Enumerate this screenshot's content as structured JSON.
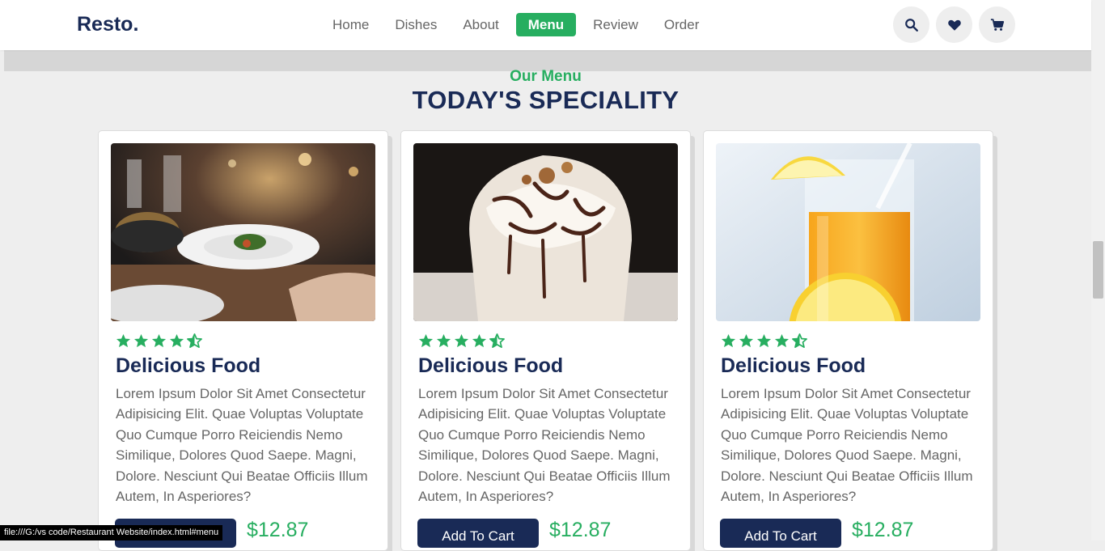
{
  "header": {
    "logo": "Resto.",
    "nav": [
      "Home",
      "Dishes",
      "About",
      "Menu",
      "Review",
      "Order"
    ],
    "active_nav": "Menu",
    "icons": [
      "search-icon",
      "heart-icon",
      "cart-icon"
    ]
  },
  "section": {
    "subheading": "Our Menu",
    "heading": "TODAY'S SPECIALITY"
  },
  "cards": [
    {
      "image": "restaurant-dinner-photo",
      "rating": 4.5,
      "title": "Delicious Food",
      "description": "Lorem Ipsum Dolor Sit Amet Consectetur Adipisicing Elit. Quae Voluptas Voluptate Quo Cumque Porro Reiciendis Nemo Similique, Dolores Quod Saepe. Magni, Dolore. Nesciunt Qui Beatae Officiis Illum Autem, In Asperiores?",
      "button": "Add To Cart",
      "price": "$12.87"
    },
    {
      "image": "whipped-cream-dessert-photo",
      "rating": 4.5,
      "title": "Delicious Food",
      "description": "Lorem Ipsum Dolor Sit Amet Consectetur Adipisicing Elit. Quae Voluptas Voluptate Quo Cumque Porro Reiciendis Nemo Similique, Dolores Quod Saepe. Magni, Dolore. Nesciunt Qui Beatae Officiis Illum Autem, In Asperiores?",
      "button": "Add To Cart",
      "price": "$12.87"
    },
    {
      "image": "orange-juice-photo",
      "rating": 4.5,
      "title": "Delicious Food",
      "description": "Lorem Ipsum Dolor Sit Amet Consectetur Adipisicing Elit. Quae Voluptas Voluptate Quo Cumque Porro Reiciendis Nemo Similique, Dolores Quod Saepe. Magni, Dolore. Nesciunt Qui Beatae Officiis Illum Autem, In Asperiores?",
      "button": "Add To Cart",
      "price": "$12.87"
    }
  ],
  "status_bar": "file:///G:/vs code/Restaurant Website/index.html#menu",
  "colors": {
    "primary": "#192a56",
    "accent": "#27ae60",
    "text": "#666666",
    "background": "#eeeeee"
  }
}
